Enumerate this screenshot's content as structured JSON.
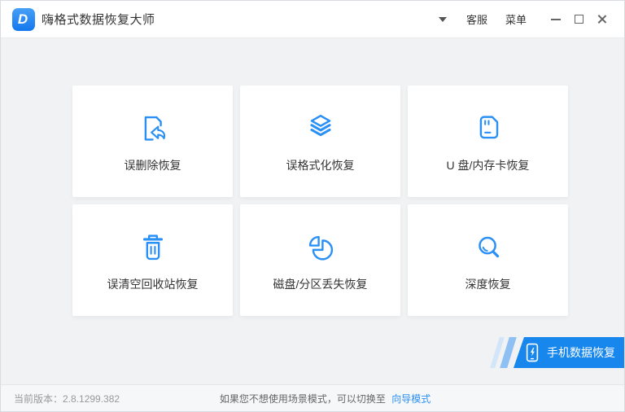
{
  "window": {
    "title": "嗨格式数据恢复大师",
    "logo_letter": "D"
  },
  "titlebar": {
    "dropdown_icon": "caret-down-icon",
    "service_label": "客服",
    "menu_label": "菜单",
    "controls": [
      "minimize",
      "maximize",
      "close"
    ]
  },
  "cards": [
    {
      "icon": "undo-delete-icon",
      "label": "误删除恢复"
    },
    {
      "icon": "layers-icon",
      "label": "误格式化恢复"
    },
    {
      "icon": "sd-card-icon",
      "label": "U 盘/内存卡恢复"
    },
    {
      "icon": "trash-icon",
      "label": "误清空回收站恢复"
    },
    {
      "icon": "pie-chart-icon",
      "label": "磁盘/分区丢失恢复"
    },
    {
      "icon": "search-icon",
      "label": "深度恢复"
    }
  ],
  "phone_button": {
    "icon": "phone-bolt-icon",
    "label": "手机数据恢复"
  },
  "statusbar": {
    "version_label": "当前版本：2.8.1299.382",
    "hint_text": "如果您不想使用场景模式，可以切换至",
    "link_label": "向导模式"
  },
  "colors": {
    "accent": "#2b90f5",
    "button_blue": "#1787ee",
    "background": "#f0f2f4"
  }
}
